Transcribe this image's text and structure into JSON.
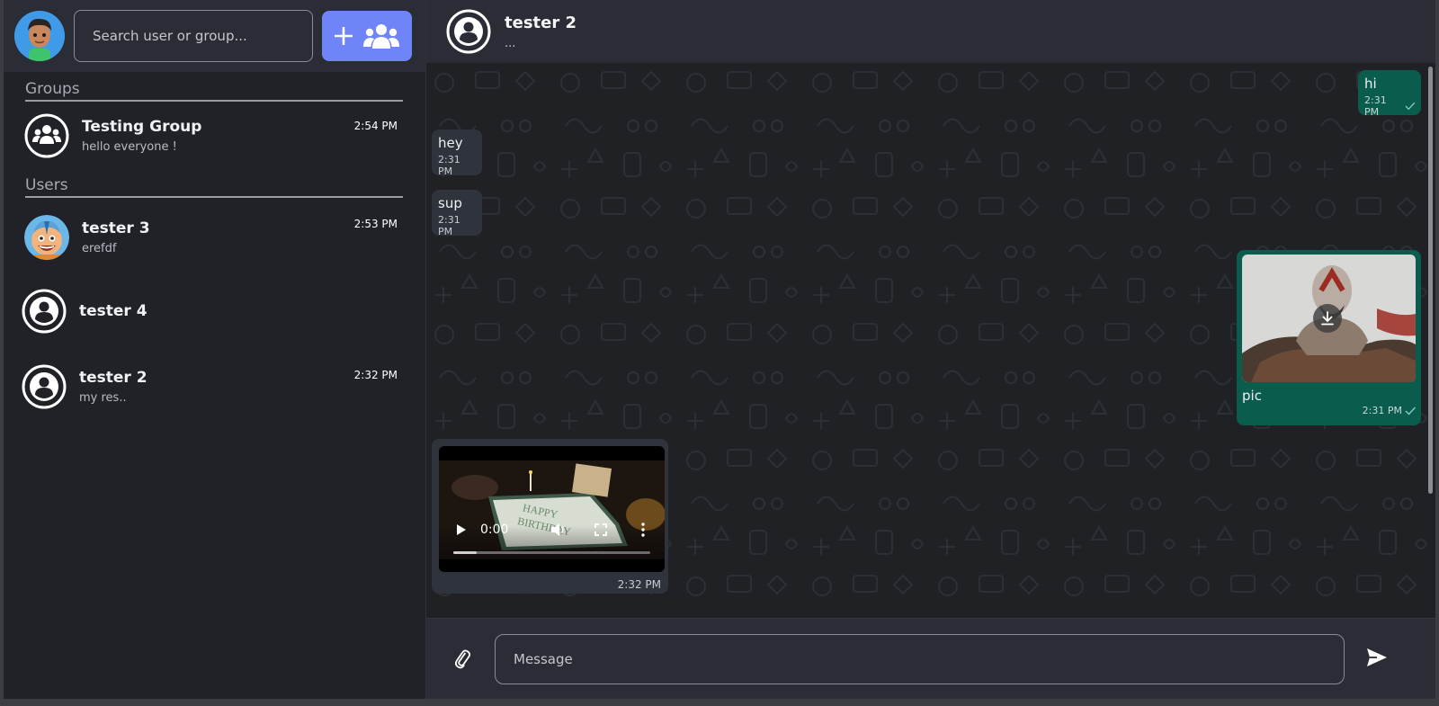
{
  "sidebar": {
    "search_placeholder": "Search user or group...",
    "sections": {
      "groups_title": "Groups",
      "users_title": "Users"
    },
    "groups": [
      {
        "name": "Testing Group",
        "preview": "hello everyone !",
        "time": "2:54 PM",
        "icon": "group-icon"
      }
    ],
    "users": [
      {
        "name": "tester 3",
        "preview": "erefdf",
        "time": "2:53 PM",
        "icon": "avatar-photo"
      },
      {
        "name": "tester 4",
        "preview": "",
        "time": "",
        "icon": "user-icon"
      },
      {
        "name": "tester 2",
        "preview": "my res..",
        "time": "2:32 PM",
        "icon": "user-icon"
      }
    ]
  },
  "chat": {
    "name": "tester 2",
    "status": "...",
    "messages": [
      {
        "direction": "out",
        "text": "hi",
        "time": "2:31 PM",
        "read": true
      },
      {
        "direction": "in",
        "text": "hey",
        "time": "2:31 PM"
      },
      {
        "direction": "in",
        "text": "sup",
        "time": "2:31 PM"
      },
      {
        "direction": "out",
        "type": "image",
        "text": "pic",
        "time": "2:31 PM",
        "read": true
      },
      {
        "direction": "in",
        "type": "video",
        "time": "2:32 PM",
        "video_time": "0:00",
        "progress": 0.12
      }
    ]
  },
  "composer": {
    "placeholder": "Message"
  },
  "colors": {
    "accent": "#6f84f6",
    "outgoing": "#0a5c4c",
    "incoming": "#2f333c",
    "panel": "#2a2d35",
    "background": "#202228"
  }
}
